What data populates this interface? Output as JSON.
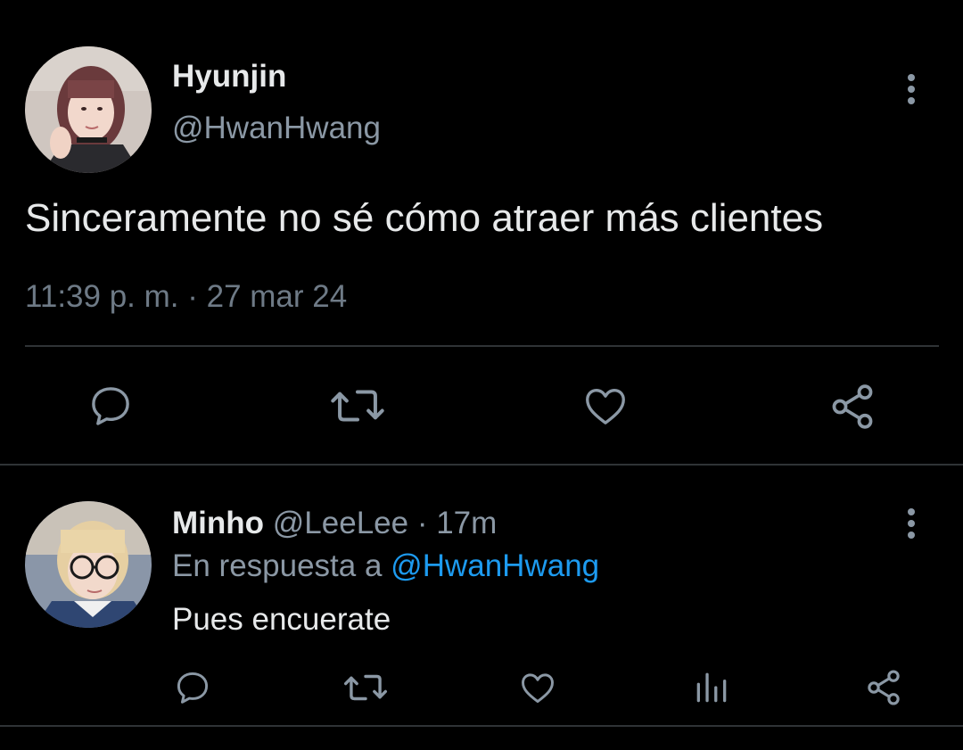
{
  "main_tweet": {
    "display_name": "Hyunjin",
    "handle": "@HwanHwang",
    "text": "Sinceramente no sé cómo atraer más clientes",
    "timestamp": "11:39 p. m. · 27 mar 24",
    "actions": [
      "reply-icon",
      "retweet-icon",
      "like-icon",
      "share-icon"
    ]
  },
  "reply_tweet": {
    "display_name": "Minho",
    "handle": "@LeeLee",
    "separator": "·",
    "time": "17m",
    "replying_prefix": "En respuesta a",
    "replying_to": "@HwanHwang",
    "text": "Pues encuerate",
    "actions": [
      "reply-icon",
      "retweet-icon",
      "like-icon",
      "views-icon",
      "share-icon"
    ]
  },
  "colors": {
    "background": "#000000",
    "primary_text": "#e7e9ea",
    "secondary_text": "#8b98a5",
    "link": "#1d9bf0",
    "divider": "#2f3336"
  }
}
